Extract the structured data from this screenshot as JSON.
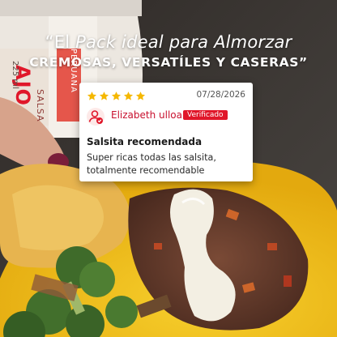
{
  "headline": {
    "line1_quote": "“El ",
    "line1_italic": "Pack ideal para Almorzar",
    "line2": "CREMOSAS, VERSATÍLES Y CASERAS”"
  },
  "jar_label": {
    "brand_vertical": "SALSA",
    "flavor": "AJO",
    "origin_vertical": "PERUANA",
    "weight": "225 ml"
  },
  "review": {
    "rating": 5,
    "date": "07/28/2026",
    "author": "Elizabeth ulloa",
    "verified_label": "Verificado",
    "title": "Salsita recomendada",
    "body": "Super ricas todas las salsita, totalmente recomendable"
  },
  "colors": {
    "star": "#f5b800",
    "accent_red": "#e0172a",
    "plate_yellow": "#f2c21a"
  }
}
